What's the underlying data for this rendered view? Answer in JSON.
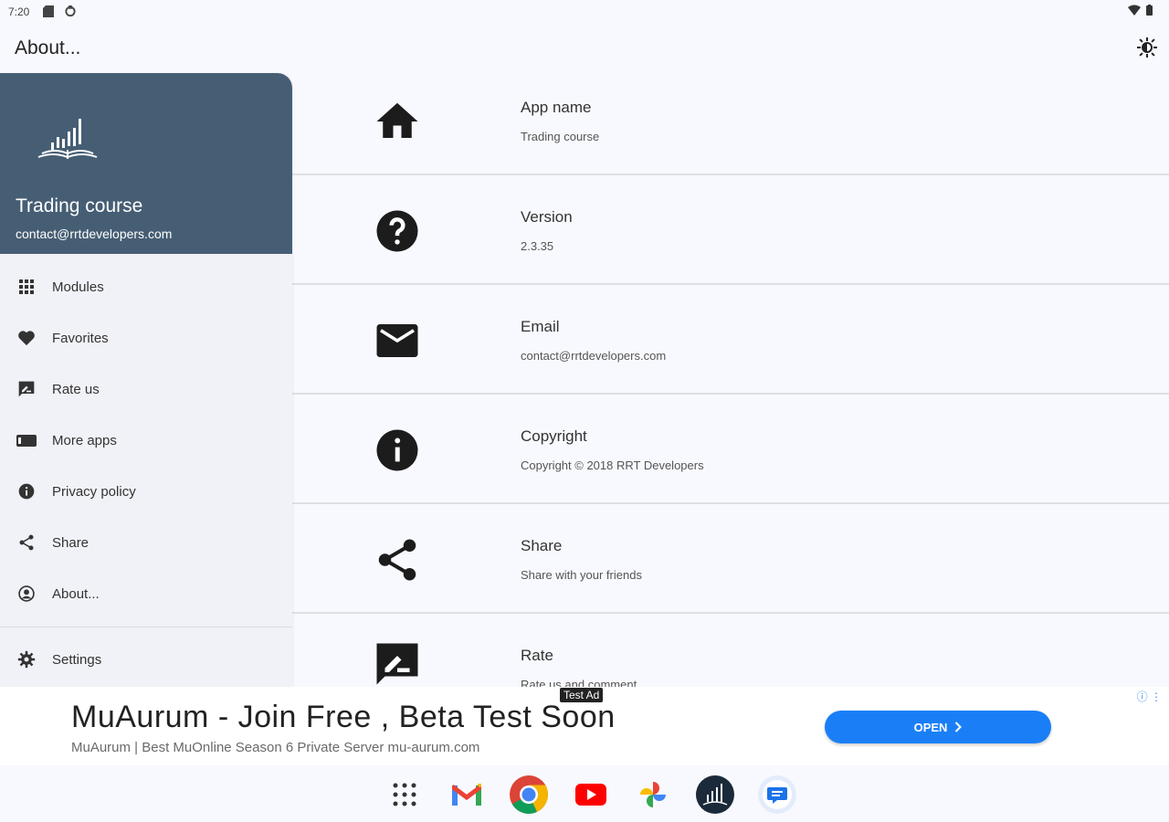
{
  "status_bar": {
    "time": "7:20"
  },
  "appbar": {
    "title": "About..."
  },
  "drawer": {
    "app_name": "Trading course",
    "email": "contact@rrtdevelopers.com",
    "items": [
      {
        "label": "Modules",
        "icon": "grid-icon"
      },
      {
        "label": "Favorites",
        "icon": "heart-icon"
      },
      {
        "label": "Rate us",
        "icon": "rate-review-icon"
      },
      {
        "label": "More apps",
        "icon": "shop-icon"
      },
      {
        "label": "Privacy policy",
        "icon": "info-icon"
      },
      {
        "label": "Share",
        "icon": "share-icon"
      },
      {
        "label": "About...",
        "icon": "account-circle-icon"
      }
    ],
    "settings": {
      "label": "Settings",
      "icon": "gear-icon"
    }
  },
  "about": {
    "rows": [
      {
        "label": "App name",
        "value": "Trading course",
        "icon": "home-icon"
      },
      {
        "label": "Version",
        "value": "2.3.35",
        "icon": "help-icon"
      },
      {
        "label": "Email",
        "value": "contact@rrtdevelopers.com",
        "icon": "mail-icon"
      },
      {
        "label": "Copyright",
        "value": "Copyright © 2018 RRT Developers",
        "icon": "info-icon"
      },
      {
        "label": "Share",
        "value": "Share with your friends",
        "icon": "share-icon"
      },
      {
        "label": "Rate",
        "value": "Rate us and comment",
        "icon": "rate-review-icon"
      }
    ]
  },
  "ad": {
    "tag": "Test Ad",
    "headline": "MuAurum - Join Free , Beta Test Soon",
    "subline": "MuAurum | Best MuOnline Season 6 Private Server mu-aurum.com",
    "button": "OPEN"
  },
  "colors": {
    "drawer_header": "#465e74",
    "ad_button": "#1a7ff7",
    "background": "#f8f9fe"
  }
}
